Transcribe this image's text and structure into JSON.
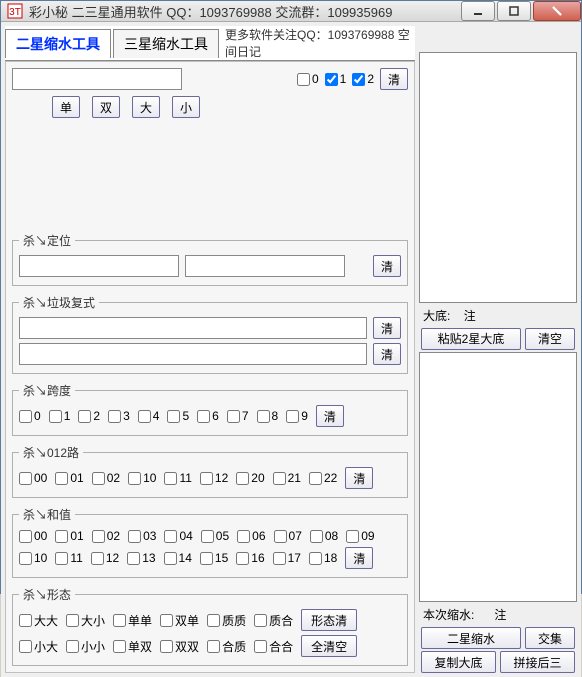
{
  "window": {
    "title": "彩小秘 二三星通用软件    QQ：1093769988   交流群：109935969"
  },
  "tabs": {
    "tab1": "二星缩水工具",
    "tab2": "三星缩水工具",
    "extra": "更多软件关注QQ：1093769988 空间日记"
  },
  "top": {
    "input": "",
    "c0": "0",
    "c1": "1",
    "c2": "2",
    "clear": "清",
    "dan": "单",
    "shuang": "双",
    "da": "大",
    "xiao": "小"
  },
  "groups": {
    "dingwei": {
      "legend": "杀↘定位",
      "clear": "清"
    },
    "lajifushi": {
      "legend": "杀↘垃圾复式",
      "clear1": "清",
      "clear2": "清"
    },
    "kuadu": {
      "legend": "杀↘跨度",
      "items": [
        "0",
        "1",
        "2",
        "3",
        "4",
        "5",
        "6",
        "7",
        "8",
        "9"
      ],
      "clear": "清"
    },
    "lu012": {
      "legend": "杀↘012路",
      "items": [
        "00",
        "01",
        "02",
        "10",
        "11",
        "12",
        "20",
        "21",
        "22"
      ],
      "clear": "清"
    },
    "hezhi": {
      "legend": "杀↘和值",
      "row1": [
        "00",
        "01",
        "02",
        "03",
        "04",
        "05",
        "06",
        "07",
        "08",
        "09"
      ],
      "row2": [
        "10",
        "11",
        "12",
        "13",
        "14",
        "15",
        "16",
        "17",
        "18"
      ],
      "clear": "清"
    },
    "xingtai": {
      "legend": "杀↘形态",
      "row1": [
        "大大",
        "大小",
        "单单",
        "双单",
        "质质",
        "质合"
      ],
      "row2": [
        "小大",
        "小小",
        "单双",
        "双双",
        "合质",
        "合合"
      ],
      "btnClearShape": "形态清",
      "btnClearAll": "全清空"
    }
  },
  "right": {
    "dadi": "大底:",
    "zhu": "注",
    "paste2": "粘贴2星大底",
    "clear": "清空",
    "benci": "本次缩水:",
    "zhu2": "注",
    "shrink2": "二星缩水",
    "jiaoji": "交集",
    "copyDadi": "复制大底",
    "pinjie": "拼接后三"
  }
}
